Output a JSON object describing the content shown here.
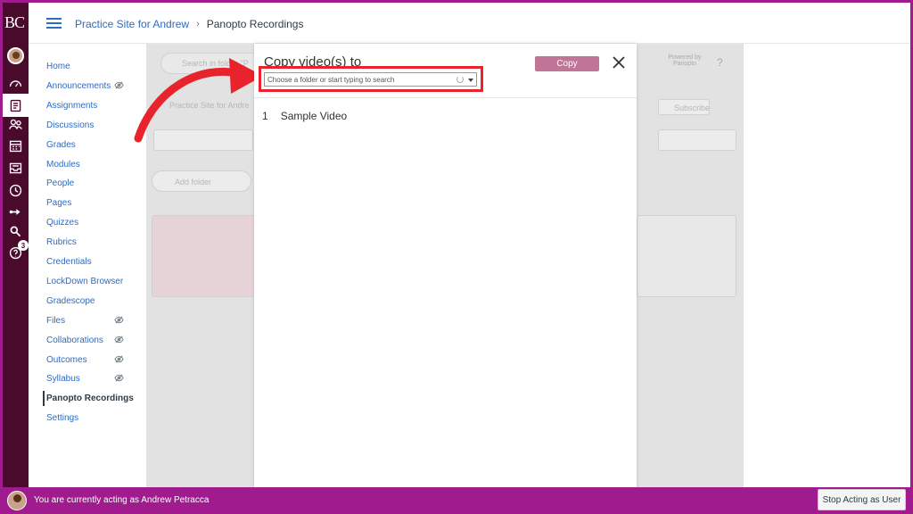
{
  "global_nav": {
    "logo": "BC",
    "help_badge": "3",
    "items": [
      "account-icon",
      "dashboard-icon",
      "courses-icon",
      "groups-icon",
      "calendar-icon",
      "inbox-icon",
      "history-icon",
      "commons-icon",
      "search-icon",
      "help-icon"
    ]
  },
  "header": {
    "course_name": "Practice Site for Andrew",
    "separator": "›",
    "page_name": "Panopto Recordings"
  },
  "course_nav": {
    "items": [
      {
        "label": "Home",
        "hidden": false
      },
      {
        "label": "Announcements",
        "hidden": true
      },
      {
        "label": "Assignments",
        "hidden": false
      },
      {
        "label": "Discussions",
        "hidden": false
      },
      {
        "label": "Grades",
        "hidden": false
      },
      {
        "label": "Modules",
        "hidden": false
      },
      {
        "label": "People",
        "hidden": false
      },
      {
        "label": "Pages",
        "hidden": false
      },
      {
        "label": "Quizzes",
        "hidden": false
      },
      {
        "label": "Rubrics",
        "hidden": false
      },
      {
        "label": "Credentials",
        "hidden": false
      },
      {
        "label": "LockDown Browser",
        "hidden": false
      },
      {
        "label": "Gradescope",
        "hidden": false
      },
      {
        "label": "Files",
        "hidden": true
      },
      {
        "label": "Collaborations",
        "hidden": true
      },
      {
        "label": "Outcomes",
        "hidden": true
      },
      {
        "label": "Syllabus",
        "hidden": true
      },
      {
        "label": "Panopto Recordings",
        "hidden": false,
        "active": true
      },
      {
        "label": "Settings",
        "hidden": false
      }
    ]
  },
  "background": {
    "search_placeholder": "Search in folder \"P",
    "folder_crumb": "Practice Site for Andre",
    "add_folder": "Add folder",
    "subscribe": "Subscribe",
    "powered_by": "Powered by Panopto",
    "help": "?"
  },
  "modal": {
    "title": "Copy video(s) to",
    "copy_button": "Copy",
    "close_icon": "close-icon",
    "folder_placeholder": "Choose a folder or start typing to search",
    "videos": [
      {
        "index": "1",
        "name": "Sample Video"
      }
    ]
  },
  "acting_bar": {
    "message": "You are currently acting as Andrew Petracca",
    "stop_button": "Stop Acting as User"
  },
  "colors": {
    "canvas_nav": "#4a0a2c",
    "acting_bar": "#a01c8e",
    "link": "#2d6bc4",
    "copy_button": "#c07596",
    "highlight": "#e8232c"
  }
}
